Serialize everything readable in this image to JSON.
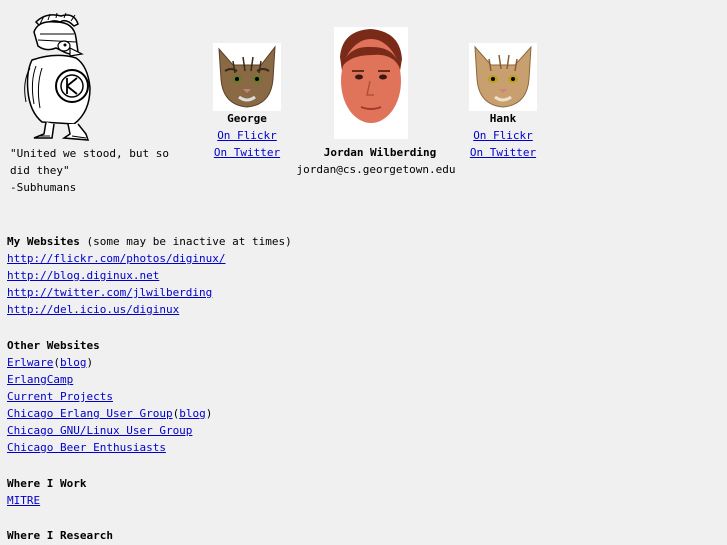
{
  "quote": {
    "line1": "\"United we stood, but so",
    "line2": "did they\"",
    "attribution": "-Subhumans"
  },
  "people": {
    "george": {
      "name": "George",
      "flickr": "On Flickr",
      "twitter": "On Twitter"
    },
    "jordan": {
      "name": "Jordan Wilberding",
      "email": "jordan@cs.georgetown.edu"
    },
    "hank": {
      "name": "Hank",
      "flickr": "On Flickr",
      "twitter": "On Twitter"
    }
  },
  "my_websites": {
    "heading": "My Websites",
    "note": " (some may be inactive at times)",
    "links": [
      "http://flickr.com/photos/diginux/",
      "http://blog.diginux.net",
      "http://twitter.com/jlwilberding",
      "http://del.icio.us/diginux"
    ]
  },
  "other_websites": {
    "heading": "Other Websites",
    "erlware": "Erlware",
    "erlware_blog": "blog",
    "erlangcamp": "ErlangCamp",
    "current_projects": "Current Projects",
    "chicago_erlang": "Chicago Erlang User Group",
    "chicago_erlang_blog": "blog",
    "chicago_gnu": "Chicago GNU/Linux User Group",
    "chicago_beer": "Chicago Beer Enthusiasts",
    "open_paren": "(",
    "close_paren": ")"
  },
  "where_work": {
    "heading": "Where I Work",
    "link": "MITRE"
  },
  "where_research": {
    "heading": "Where I Research"
  },
  "colors": {
    "background": "#f0f0f0",
    "link": "#0000cc"
  }
}
